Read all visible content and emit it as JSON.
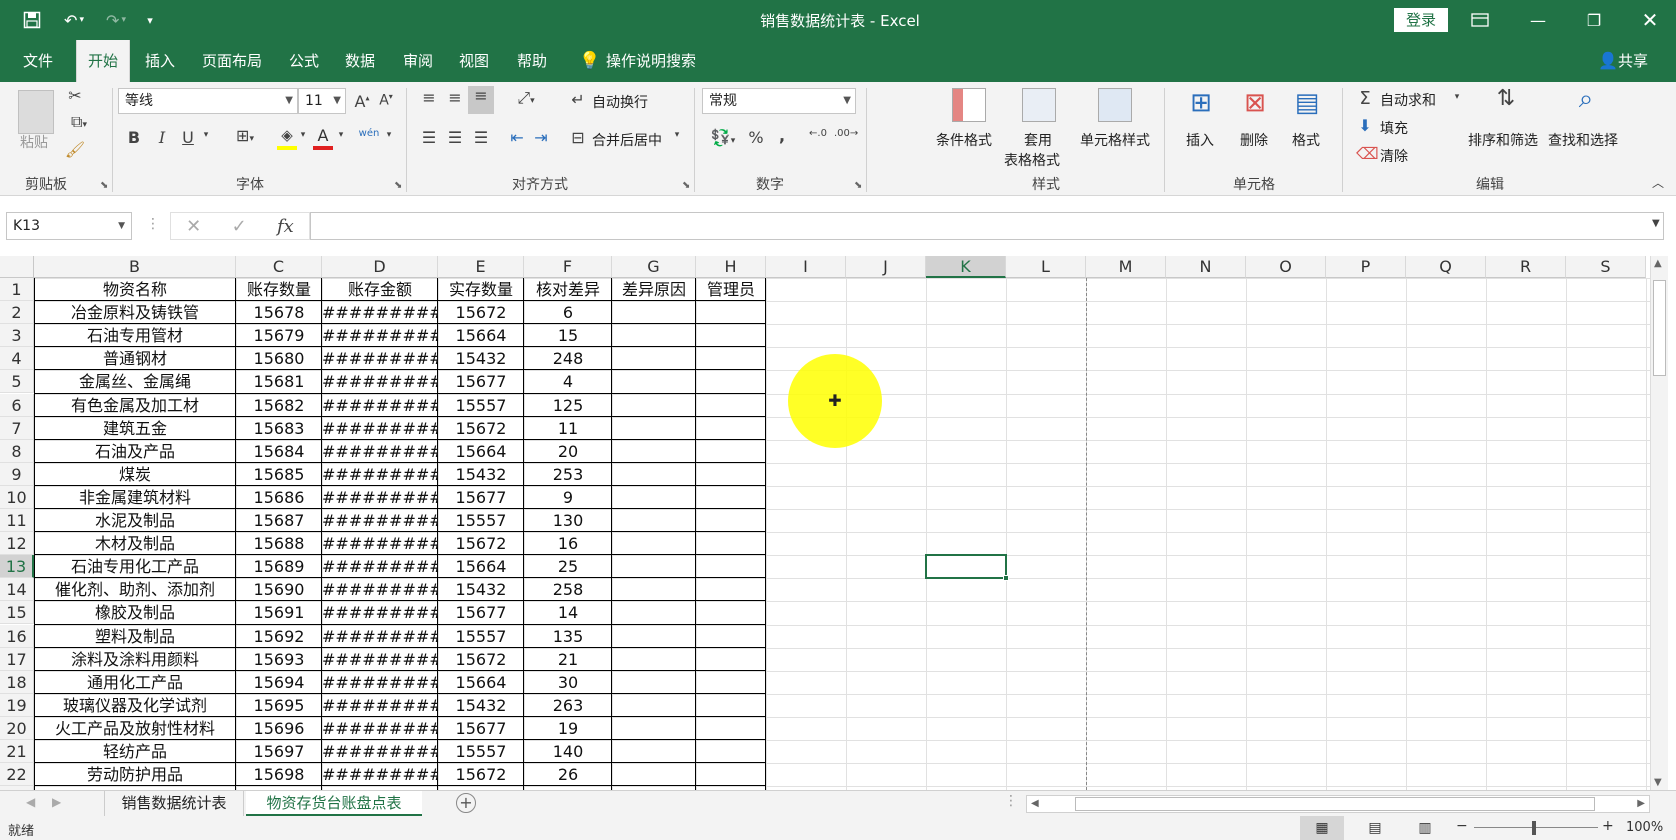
{
  "title": {
    "text": "销售数据统计表  -  Excel",
    "login": "登录"
  },
  "menu": {
    "items": [
      "文件",
      "开始",
      "插入",
      "页面布局",
      "公式",
      "数据",
      "审阅",
      "视图",
      "帮助"
    ],
    "search": "操作说明搜索",
    "share": "共享"
  },
  "ribbon": {
    "clipboard": {
      "label": "剪贴板",
      "paste": "粘贴"
    },
    "font": {
      "label": "字体",
      "name": "等线",
      "size": "11",
      "bold": "B",
      "italic": "I",
      "underline": "U",
      "phonetic": "wén"
    },
    "alignment": {
      "label": "对齐方式",
      "wrap": "自动换行",
      "merge": "合并后居中"
    },
    "number": {
      "label": "数字",
      "format": "常规",
      "percent": "%",
      "comma": ","
    },
    "styles": {
      "label": "样式",
      "conditional": "条件格式",
      "table1": "套用",
      "table2": "表格格式",
      "cell_styles": "单元格样式"
    },
    "cells": {
      "label": "单元格",
      "insert": "插入",
      "delete": "删除",
      "format": "格式"
    },
    "editing": {
      "label": "编辑",
      "autosum": "自动求和",
      "fill": "填充",
      "clear": "清除",
      "sort": "排序和筛选",
      "find": "查找和选择"
    }
  },
  "formula_bar": {
    "name_box": "K13",
    "fx": "fx",
    "value": ""
  },
  "grid": {
    "columns": [
      "B",
      "C",
      "D",
      "E",
      "F",
      "G",
      "H",
      "I",
      "J",
      "K",
      "L",
      "M",
      "N",
      "O",
      "P",
      "Q",
      "R",
      "S"
    ],
    "headers": [
      "物资名称",
      "账存数量",
      "账存金额",
      "实存数量",
      "核对差异",
      "差异原因",
      "管理员"
    ],
    "rows": [
      {
        "n": "2",
        "name": "冶金原料及铸铁管",
        "qty": "15678",
        "amt": "#########",
        "real": "15672",
        "diff": "6"
      },
      {
        "n": "3",
        "name": "石油专用管材",
        "qty": "15679",
        "amt": "#########",
        "real": "15664",
        "diff": "15"
      },
      {
        "n": "4",
        "name": "普通钢材",
        "qty": "15680",
        "amt": "#########",
        "real": "15432",
        "diff": "248"
      },
      {
        "n": "5",
        "name": "金属丝、金属绳",
        "qty": "15681",
        "amt": "#########",
        "real": "15677",
        "diff": "4"
      },
      {
        "n": "6",
        "name": "有色金属及加工材",
        "qty": "15682",
        "amt": "#########",
        "real": "15557",
        "diff": "125"
      },
      {
        "n": "7",
        "name": "建筑五金",
        "qty": "15683",
        "amt": "#########",
        "real": "15672",
        "diff": "11"
      },
      {
        "n": "8",
        "name": "石油及产品",
        "qty": "15684",
        "amt": "#########",
        "real": "15664",
        "diff": "20"
      },
      {
        "n": "9",
        "name": "煤炭",
        "qty": "15685",
        "amt": "#########",
        "real": "15432",
        "diff": "253"
      },
      {
        "n": "10",
        "name": "非金属建筑材料",
        "qty": "15686",
        "amt": "#########",
        "real": "15677",
        "diff": "9"
      },
      {
        "n": "11",
        "name": "水泥及制品",
        "qty": "15687",
        "amt": "#########",
        "real": "15557",
        "diff": "130"
      },
      {
        "n": "12",
        "name": "木材及制品",
        "qty": "15688",
        "amt": "#########",
        "real": "15672",
        "diff": "16"
      },
      {
        "n": "13",
        "name": "石油专用化工产品",
        "qty": "15689",
        "amt": "#########",
        "real": "15664",
        "diff": "25"
      },
      {
        "n": "14",
        "name": "催化剂、助剂、添加剂",
        "qty": "15690",
        "amt": "#########",
        "real": "15432",
        "diff": "258"
      },
      {
        "n": "15",
        "name": "橡胶及制品",
        "qty": "15691",
        "amt": "#########",
        "real": "15677",
        "diff": "14"
      },
      {
        "n": "16",
        "name": "塑料及制品",
        "qty": "15692",
        "amt": "#########",
        "real": "15557",
        "diff": "135"
      },
      {
        "n": "17",
        "name": "涂料及涂料用颜料",
        "qty": "15693",
        "amt": "#########",
        "real": "15672",
        "diff": "21"
      },
      {
        "n": "18",
        "name": "通用化工产品",
        "qty": "15694",
        "amt": "#########",
        "real": "15664",
        "diff": "30"
      },
      {
        "n": "19",
        "name": "玻璃仪器及化学试剂",
        "qty": "15695",
        "amt": "#########",
        "real": "15432",
        "diff": "263"
      },
      {
        "n": "20",
        "name": "火工产品及放射性材料",
        "qty": "15696",
        "amt": "#########",
        "real": "15677",
        "diff": "19"
      },
      {
        "n": "21",
        "name": "轻纺产品",
        "qty": "15697",
        "amt": "#########",
        "real": "15557",
        "diff": "140"
      },
      {
        "n": "22",
        "name": "劳动防护用品",
        "qty": "15698",
        "amt": "#########",
        "real": "15672",
        "diff": "26"
      }
    ]
  },
  "sheets": {
    "tabs": [
      "销售数据统计表",
      "物资存货台账盘点表"
    ],
    "active": 1
  },
  "status": {
    "ready": "就绪",
    "zoom": "100%"
  },
  "colors": {
    "accent": "#217346",
    "cursor": "#ffff00"
  }
}
